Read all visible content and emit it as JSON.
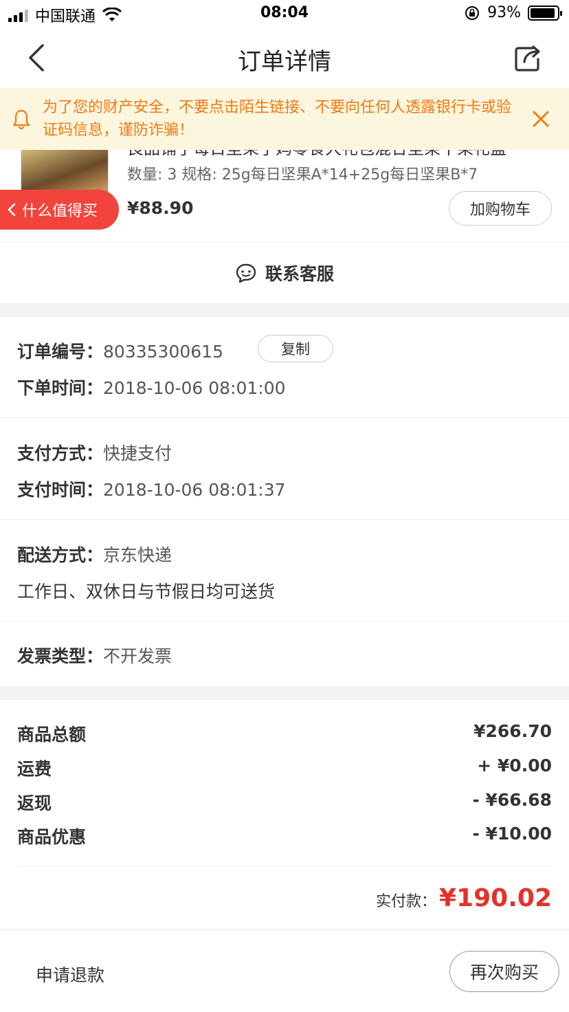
{
  "status_bar": {
    "carrier": "中国联通",
    "time": "08:04",
    "battery": "93%"
  },
  "nav": {
    "title": "订单详情"
  },
  "warning": {
    "text": "为了您的财产安全，不要点击陌生链接、不要向任何人透露银行卡或验证码信息，谨防诈骗！",
    "color": "#f27a12"
  },
  "product": {
    "title": "良品铺子每日坚果子妈零食大礼包混合坚果干果礼盒",
    "spec": "数量: 3 规格: 25g每日坚果A*14+25g每日坚果B*7",
    "price": "¥88.90",
    "add_cart_label": "加购物车"
  },
  "float_tag": {
    "label": "什么值得买"
  },
  "contact": {
    "label": "联系客服"
  },
  "order": {
    "number_key": "订单编号：",
    "number_val": "80335300615",
    "copy_label": "复制",
    "time_key": "下单时间：",
    "time_val": "2018-10-06 08:01:00"
  },
  "payment": {
    "method_key": "支付方式：",
    "method_val": "快捷支付",
    "time_key": "支付时间：",
    "time_val": "2018-10-06 08:01:37"
  },
  "delivery": {
    "method_key": "配送方式：",
    "method_val": "京东快递",
    "note": "工作日、双休日与节假日均可送货"
  },
  "invoice": {
    "type_key": "发票类型：",
    "type_val": "不开发票"
  },
  "amounts": {
    "items": [
      {
        "label": "商品总额",
        "value": "¥266.70"
      },
      {
        "label": "运费",
        "value": "+ ¥0.00"
      },
      {
        "label": "返现",
        "value": "- ¥66.68"
      },
      {
        "label": "商品优惠",
        "value": "- ¥10.00"
      }
    ],
    "paid_label": "实付款：",
    "paid_value": "¥190.02",
    "paid_color": "#e4322b"
  },
  "bottom": {
    "refund_label": "申请退款",
    "rebuy_label": "再次购买"
  }
}
